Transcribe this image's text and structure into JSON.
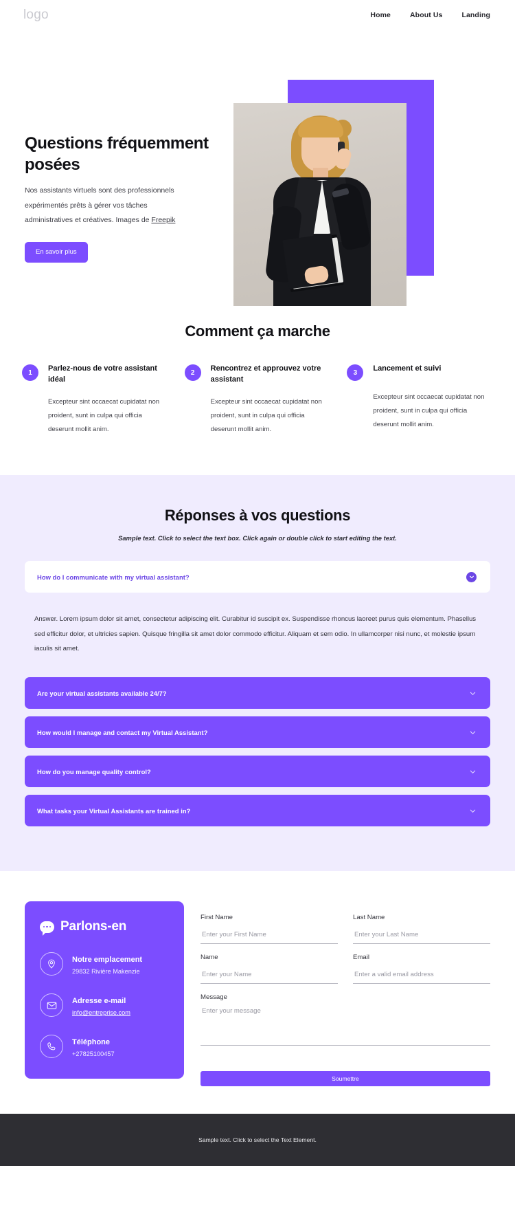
{
  "header": {
    "logo": "logo",
    "nav": [
      {
        "label": "Home"
      },
      {
        "label": "About Us"
      },
      {
        "label": "Landing"
      }
    ]
  },
  "hero": {
    "title": "Questions fréquemment posées",
    "subtitle_before": "Nos assistants virtuels sont des professionnels expérimentés prêts à gérer vos tâches administratives et créatives. Images de ",
    "subtitle_link": "Freepik",
    "cta_label": "En savoir plus",
    "accent_color": "#7c4dff"
  },
  "how": {
    "title": "Comment ça marche",
    "steps": [
      {
        "number": "1",
        "title": "Parlez-nous de votre assistant idéal",
        "body": "Excepteur sint occaecat cupidatat non proident, sunt in culpa qui officia deserunt mollit anim."
      },
      {
        "number": "2",
        "title": "Rencontrez et approuvez votre assistant",
        "body": "Excepteur sint occaecat cupidatat non proident, sunt in culpa qui officia deserunt mollit anim."
      },
      {
        "number": "3",
        "title": "Lancement et suivi",
        "body": "Excepteur sint occaecat cupidatat non proident, sunt in culpa qui officia deserunt mollit anim."
      }
    ]
  },
  "faq": {
    "title": "Réponses à vos questions",
    "subtitle": "Sample text. Click to select the text box. Click again or double click to start editing the text.",
    "open_item": {
      "question": "How do I communicate with my virtual assistant?",
      "answer": "Answer. Lorem ipsum dolor sit amet, consectetur adipiscing elit. Curabitur id suscipit ex. Suspendisse rhoncus laoreet purus quis elementum. Phasellus sed efficitur dolor, et ultricies sapien. Quisque fringilla sit amet dolor commodo efficitur. Aliquam et sem odio. In ullamcorper nisi nunc, et molestie ipsum iaculis sit amet."
    },
    "closed_items": [
      {
        "question": "Are your virtual assistants available 24/7?"
      },
      {
        "question": "How would I manage and contact my Virtual Assistant?"
      },
      {
        "question": "How do you manage quality control?"
      },
      {
        "question": "What tasks your Virtual Assistants are trained in?"
      }
    ]
  },
  "contact": {
    "card_title": "Parlons-en",
    "rows": [
      {
        "label": "Notre emplacement",
        "value": "29832 Rivière Makenzie",
        "icon": "location-pin-icon"
      },
      {
        "label": "Adresse e-mail",
        "value": "info@entreprise.com",
        "icon": "envelope-icon"
      },
      {
        "label": "Téléphone",
        "value": "+27825100457",
        "icon": "phone-icon"
      }
    ],
    "form": {
      "first_name_label": "First Name",
      "first_name_placeholder": "Enter your First Name",
      "last_name_label": "Last Name",
      "last_name_placeholder": "Enter your Last Name",
      "name_label": "Name",
      "name_placeholder": "Enter your Name",
      "email_label": "Email",
      "email_placeholder": "Enter a valid email address",
      "message_label": "Message",
      "message_placeholder": "Enter your message",
      "submit_label": "Soumettre"
    }
  },
  "footer": {
    "text": "Sample text. Click to select the Text Element."
  }
}
